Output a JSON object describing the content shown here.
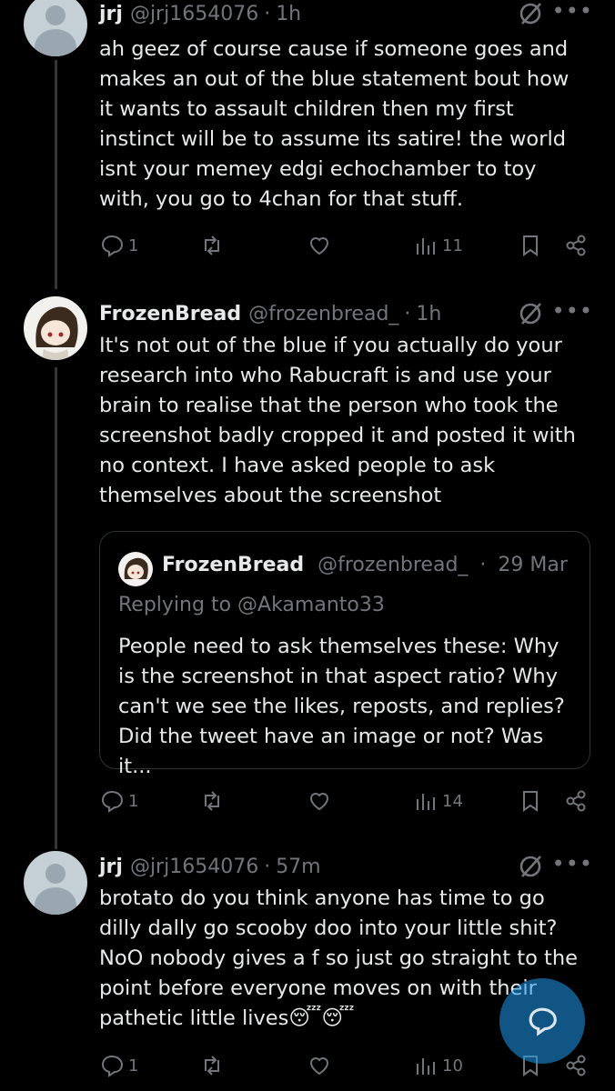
{
  "tweets": [
    {
      "name": "jrj",
      "handle": "@jrj1654076",
      "sep": "·",
      "time": "1h",
      "text": "ah geez of course cause if someone goes and makes an out of the blue statement bout how it wants to assault children then my first instinct will be to assume its satire! the world isnt your memey edgi echochamber to toy with, you go to 4chan for that stuff.",
      "replies": "1",
      "reposts": "",
      "likes": "",
      "views": "11"
    },
    {
      "name": "FrozenBread",
      "handle": "@frozenbread_",
      "sep": "·",
      "time": "1h",
      "text": "It's not out of the blue if you actually do your research into who Rabucraft is and use your brain to realise that the person who took the screenshot badly cropped it and posted it with no context. I have asked people to ask themselves about the screenshot",
      "quote": {
        "name": "FrozenBread",
        "handle": "@frozenbread_",
        "sep": "·",
        "time": "29 Mar",
        "replying_to": "Replying to @Akamanto33",
        "text": "People need to ask themselves these: Why is the screenshot in that aspect ratio? Why can't we see the likes, reposts, and replies? Did the tweet have an image or not? Was it..."
      },
      "replies": "1",
      "reposts": "",
      "likes": "",
      "views": "14"
    },
    {
      "name": "jrj",
      "handle": "@jrj1654076",
      "sep": "·",
      "time": "57m",
      "text": "brotato do you think anyone has time to go dilly dally go scooby doo into your little shit? NoO nobody gives a f so just go straight to the point before everyone moves on with their pathetic little lives😴😴",
      "replies": "1",
      "reposts": "",
      "likes": "",
      "views": "10"
    }
  ],
  "icons": {
    "reply": "reply-icon",
    "repost": "repost-icon",
    "like": "heart-icon",
    "views": "views-icon",
    "bookmark": "bookmark-icon",
    "share": "share-icon",
    "grok": "grok-icon",
    "more": "more-icon",
    "compose": "compose-reply-icon"
  },
  "more_glyph": "•••",
  "colors": {
    "background": "#000000",
    "text": "#e7e9ea",
    "secondary": "#71767b",
    "accent": "#1d9bf0"
  }
}
